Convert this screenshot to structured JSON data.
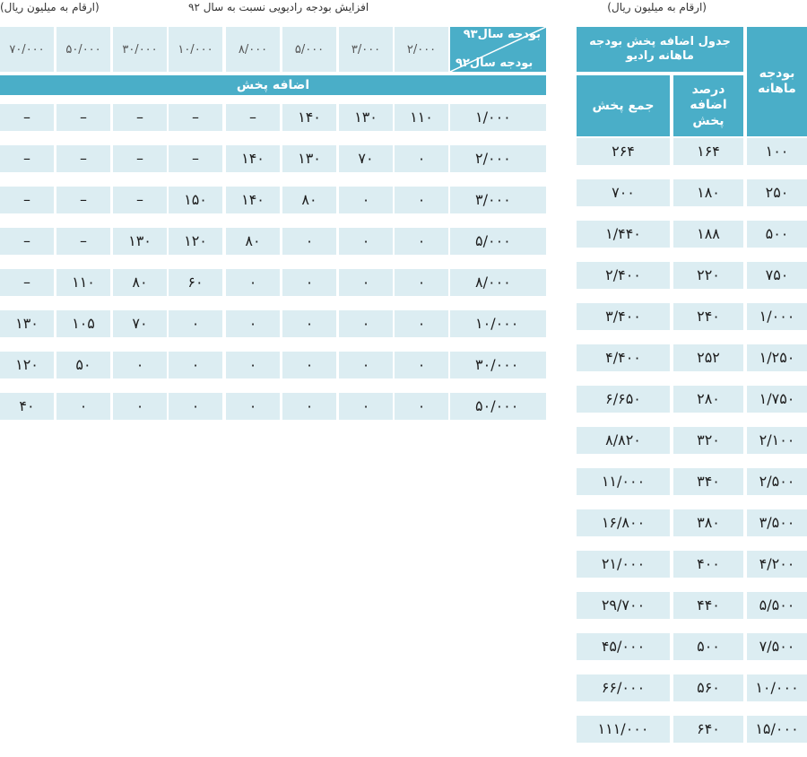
{
  "notes": {
    "right_unit": "(ارقام به میلیون ریال)",
    "left_unit": "(ارقام به میلیون ریال)",
    "left_title": "افزایش بودجه رادیویی نسبت به سال ۹۲"
  },
  "right_table": {
    "col_budget_header": "بودجه ماهانه",
    "title_header": "جدول اضافه پخش بودجه ماهانه رادیو",
    "col_percent_header": "درصد اضافه پخش",
    "col_total_header": "جمع پخش",
    "rows": [
      {
        "budget": "۱۰۰",
        "percent": "۱۶۴",
        "total": "۲۶۴"
      },
      {
        "budget": "۲۵۰",
        "percent": "۱۸۰",
        "total": "۷۰۰"
      },
      {
        "budget": "۵۰۰",
        "percent": "۱۸۸",
        "total": "۱/۴۴۰"
      },
      {
        "budget": "۷۵۰",
        "percent": "۲۲۰",
        "total": "۲/۴۰۰"
      },
      {
        "budget": "۱/۰۰۰",
        "percent": "۲۴۰",
        "total": "۳/۴۰۰"
      },
      {
        "budget": "۱/۲۵۰",
        "percent": "۲۵۲",
        "total": "۴/۴۰۰"
      },
      {
        "budget": "۱/۷۵۰",
        "percent": "۲۸۰",
        "total": "۶/۶۵۰"
      },
      {
        "budget": "۲/۱۰۰",
        "percent": "۳۲۰",
        "total": "۸/۸۲۰"
      },
      {
        "budget": "۲/۵۰۰",
        "percent": "۳۴۰",
        "total": "۱۱/۰۰۰"
      },
      {
        "budget": "۳/۵۰۰",
        "percent": "۳۸۰",
        "total": "۱۶/۸۰۰"
      },
      {
        "budget": "۴/۲۰۰",
        "percent": "۴۰۰",
        "total": "۲۱/۰۰۰"
      },
      {
        "budget": "۵/۵۰۰",
        "percent": "۴۴۰",
        "total": "۲۹/۷۰۰"
      },
      {
        "budget": "۷/۵۰۰",
        "percent": "۵۰۰",
        "total": "۴۵/۰۰۰"
      },
      {
        "budget": "۱۰/۰۰۰",
        "percent": "۵۶۰",
        "total": "۶۶/۰۰۰"
      },
      {
        "budget": "۱۵/۰۰۰",
        "percent": "۶۴۰",
        "total": "۱۱۱/۰۰۰"
      }
    ]
  },
  "left_table": {
    "corner_year93": "بودجه سال۹۳",
    "corner_year92": "بودجه سال۹۲",
    "band_label": "اضافه پخش",
    "columns": [
      "۲/۰۰۰",
      "۳/۰۰۰",
      "۵/۰۰۰",
      "۸/۰۰۰",
      "۱۰/۰۰۰",
      "۳۰/۰۰۰",
      "۵۰/۰۰۰",
      "۷۰/۰۰۰"
    ],
    "rows": [
      {
        "label": "۱/۰۰۰",
        "cells": [
          "۱۱۰",
          "۱۳۰",
          "۱۴۰",
          "–",
          "–",
          "–",
          "–",
          "–"
        ]
      },
      {
        "label": "۲/۰۰۰",
        "cells": [
          "۰",
          "۷۰",
          "۱۳۰",
          "۱۴۰",
          "–",
          "–",
          "–",
          "–"
        ]
      },
      {
        "label": "۳/۰۰۰",
        "cells": [
          "۰",
          "۰",
          "۸۰",
          "۱۴۰",
          "۱۵۰",
          "–",
          "–",
          "–"
        ]
      },
      {
        "label": "۵/۰۰۰",
        "cells": [
          "۰",
          "۰",
          "۰",
          "۸۰",
          "۱۲۰",
          "۱۳۰",
          "–",
          "–"
        ]
      },
      {
        "label": "۸/۰۰۰",
        "cells": [
          "۰",
          "۰",
          "۰",
          "۰",
          "۶۰",
          "۸۰",
          "۱۱۰",
          "–"
        ]
      },
      {
        "label": "۱۰/۰۰۰",
        "cells": [
          "۰",
          "۰",
          "۰",
          "۰",
          "۰",
          "۷۰",
          "۱۰۵",
          "۱۳۰"
        ]
      },
      {
        "label": "۳۰/۰۰۰",
        "cells": [
          "۰",
          "۰",
          "۰",
          "۰",
          "۰",
          "۰",
          "۵۰",
          "۱۲۰"
        ]
      },
      {
        "label": "۵۰/۰۰۰",
        "cells": [
          "۰",
          "۰",
          "۰",
          "۰",
          "۰",
          "۰",
          "۰",
          "۴۰"
        ]
      }
    ]
  },
  "colors": {
    "header": "#4aaec8",
    "cell": "#dcedf2"
  }
}
